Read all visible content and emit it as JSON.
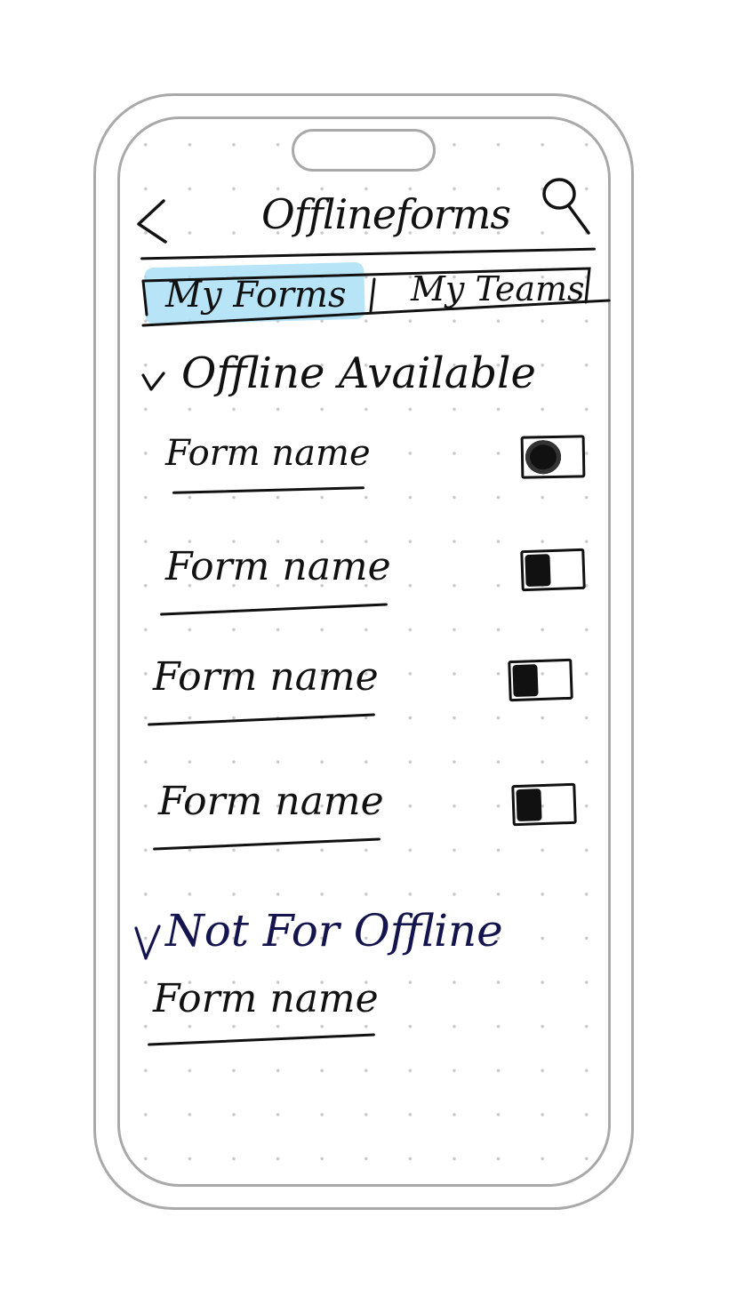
{
  "header": {
    "back_icon": "chevron-left-icon",
    "title": "Offlineforms",
    "search_icon": "search-icon"
  },
  "tabs": [
    {
      "label": "My Forms",
      "selected": true
    },
    {
      "label": "My Teams",
      "selected": false
    }
  ],
  "sections": {
    "available": {
      "heading": "Offline Available",
      "chevron_icon": "chevron-down-icon",
      "items": [
        {
          "label": "Form name",
          "toggle_on": true
        },
        {
          "label": "Form name",
          "toggle_on": false
        },
        {
          "label": "Form name",
          "toggle_on": false
        },
        {
          "label": "Form name",
          "toggle_on": false
        }
      ]
    },
    "unavailable": {
      "heading": "Not For Offline",
      "chevron_icon": "chevron-down-icon",
      "items": [
        {
          "label": "Form name"
        }
      ]
    }
  },
  "colors": {
    "ink": "#111111",
    "ink_blue": "#14144f",
    "highlight": "#9fdcf4",
    "frame": "#a9a9a9",
    "grid_dot": "#c9c9c9"
  }
}
